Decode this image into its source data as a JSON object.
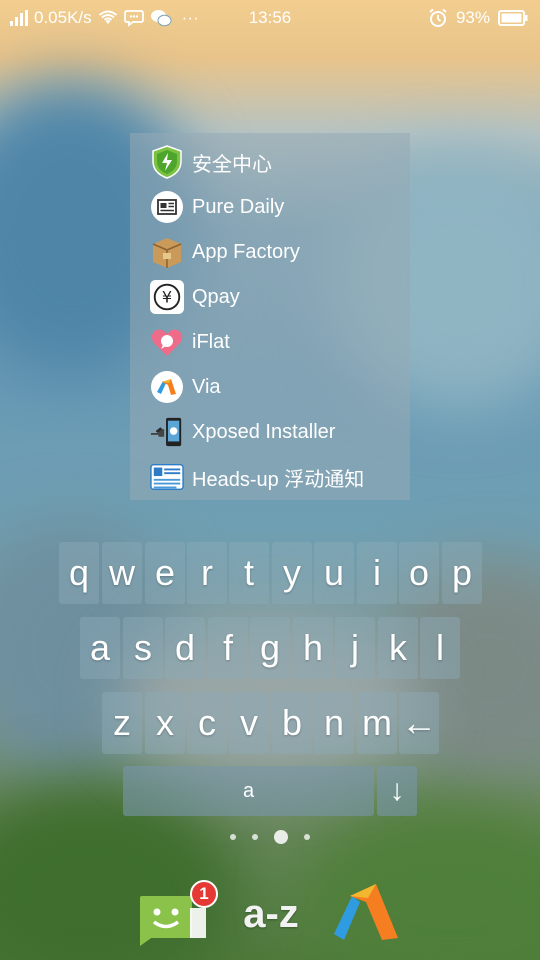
{
  "status_bar": {
    "network_speed": "0.05K/s",
    "time": "13:56",
    "battery_percent": "93%",
    "more_indicator": "···"
  },
  "app_list": [
    {
      "label": "安全中心",
      "icon": "security-center-icon"
    },
    {
      "label": "Pure Daily",
      "icon": "pure-daily-icon"
    },
    {
      "label": "App Factory",
      "icon": "app-factory-icon"
    },
    {
      "label": "Qpay",
      "icon": "qpay-icon"
    },
    {
      "label": "iFlat",
      "icon": "iflat-icon"
    },
    {
      "label": "Via",
      "icon": "via-icon"
    },
    {
      "label": "Xposed Installer",
      "icon": "xposed-installer-icon"
    },
    {
      "label": "Heads-up 浮动通知",
      "icon": "heads-up-icon"
    }
  ],
  "keyboard": {
    "row1": [
      "q",
      "w",
      "e",
      "r",
      "t",
      "y",
      "u",
      "i",
      "o",
      "p"
    ],
    "row2": [
      "a",
      "s",
      "d",
      "f",
      "g",
      "h",
      "j",
      "k",
      "l"
    ],
    "row3": [
      "z",
      "x",
      "c",
      "v",
      "b",
      "n",
      "m"
    ],
    "backspace": "←",
    "space_label": "a",
    "enter": "↓"
  },
  "page_indicator": {
    "count": 4,
    "active_index": 2
  },
  "dock": {
    "messages_badge": "1",
    "az_label": "a-z"
  },
  "colors": {
    "panel": "#96aab4",
    "badge": "#e53935",
    "messages_green": "#8bc34a"
  }
}
